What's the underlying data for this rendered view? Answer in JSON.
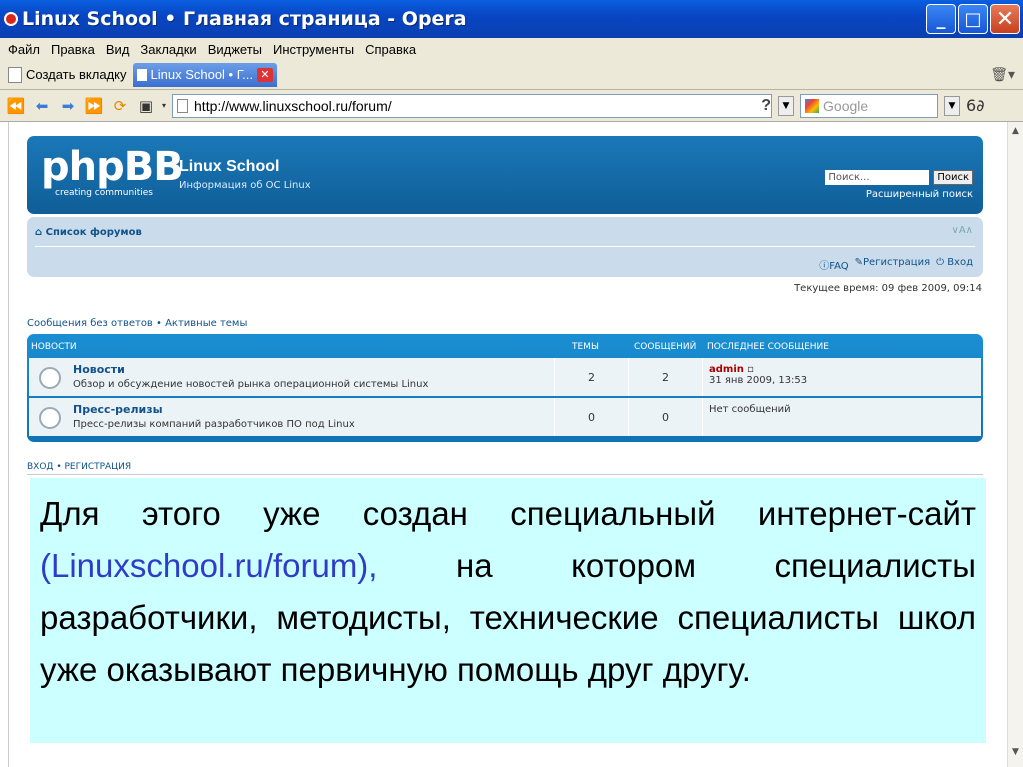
{
  "window": {
    "title": "Linux School • Главная страница - Opera"
  },
  "menu": {
    "items": [
      "Файл",
      "Правка",
      "Вид",
      "Закладки",
      "Виджеты",
      "Инструменты",
      "Справка"
    ]
  },
  "tabs": {
    "new_tab_label": "Создать вкладку",
    "active_label": "Linux School • Г..."
  },
  "address": {
    "url": "http://www.linuxschool.ru/forum/",
    "search_placeholder": "Google"
  },
  "header": {
    "logo": "phpBB",
    "logo_sub": "creating communities",
    "site_title": "Linux School",
    "site_desc": "Информация об ОС Linux",
    "search_placeholder": "Поиск...",
    "search_button": "Поиск",
    "advanced_search": "Расширенный поиск"
  },
  "navbar": {
    "forum_list": "Список форумов",
    "resize": "∨A∧",
    "faq": "FAQ",
    "register": "Регистрация",
    "login": "Вход"
  },
  "current_time": "Текущее время: 09 фев 2009, 09:14",
  "quick_links": "Сообщения без ответов • Активные темы",
  "forum_table": {
    "headers": {
      "category": "НОВОСТИ",
      "topics": "ТЕМЫ",
      "posts": "СООБЩЕНИЙ",
      "last": "ПОСЛЕДНЕЕ СООБЩЕНИЕ"
    },
    "rows": [
      {
        "name": "Новости",
        "desc": "Обзор и обсуждение новостей рынка операционной системы Linux",
        "topics": "2",
        "posts": "2",
        "last_author": "admin",
        "last_date": "31 янв 2009, 13:53"
      },
      {
        "name": "Пресс-релизы",
        "desc": "Пресс-релизы компаний разработчиков ПО под Linux",
        "topics": "0",
        "posts": "0",
        "last_none": "Нет сообщений"
      }
    ]
  },
  "login_register": "ВХОД • РЕГИСТРАЦИЯ",
  "overlay": {
    "line1": "Для этого уже создан специальный интернет-сайт",
    "link": "(Linuxschool.ru/forum),",
    "line2_rest": "на котором специалисты",
    "line3": "разработчики, методисты, технические",
    "line4": "специалисты школ уже оказывают первичную",
    "line5": "помощь друг другу."
  }
}
